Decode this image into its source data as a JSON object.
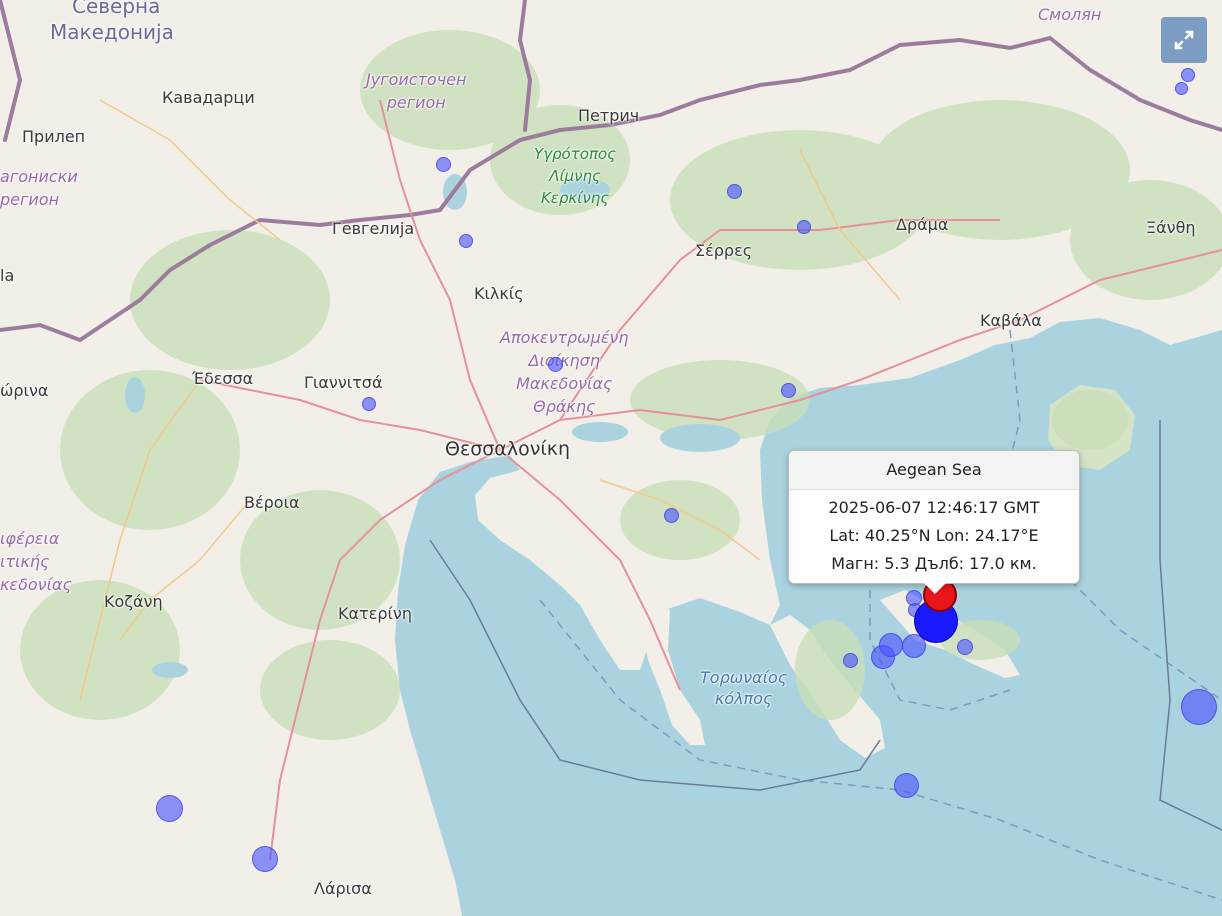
{
  "popup": {
    "title": "Aegean Sea",
    "datetime": "2025-06-07 12:46:17 GMT",
    "location": "Lat: 40.25°N Lon: 24.17°E",
    "details": "Магн: 5.3 Дълб: 17.0 км."
  },
  "labels": {
    "severna_makedonija": [
      "Северна",
      "Македонија"
    ],
    "smolyan": "Смолян",
    "kavadarci": "Кавадарци",
    "jugoistochen": [
      "Југоисточен",
      "регион"
    ],
    "petrich": "Петрич",
    "prilep": "Прилеп",
    "pelagoniski": [
      "агониски",
      "регион"
    ],
    "lake_kerkini": [
      "Υγρότοπος",
      "Λίμνης",
      "Κερκίνης"
    ],
    "gevgelija": "Гевгелија",
    "serres": "Σέρρες",
    "drama": "Δράμα",
    "xanthi": "Ξάνθη",
    "kilkis": "Κιλκίς",
    "kavala": "Καβάλα",
    "decentralized_admin": [
      "Αποκεντρωμένη",
      "Διοίκηση",
      "Μακεδονίας",
      "Θράκης"
    ],
    "edessa": "Έδεσσα",
    "giannitsa": "Γιαννιτσά",
    "florina": "ώρινα",
    "thessaloniki": "Θεσσαλονίκη",
    "veroia": "Βέροια",
    "periferia": [
      "ιφέρεια",
      "ιτικής",
      "κεδονίας"
    ],
    "kozani": "Κοζάνη",
    "katerini": "Κατερίνη",
    "toronaios": [
      "Τορωναίος",
      "κόλπος"
    ],
    "larisa": "Λάρισα",
    "left_edge": "la"
  },
  "icons": {
    "fullscreen": "fullscreen-icon",
    "marker": "map-marker-icon"
  },
  "colors": {
    "sea": "#aad3df",
    "land": "#f2efe9",
    "forest": "#c8dfb8",
    "quake_small": "#6670ff",
    "quake_main": "#1a1aff",
    "marker": "#e8151b",
    "fullscreen_button": "#7d9cc3"
  }
}
